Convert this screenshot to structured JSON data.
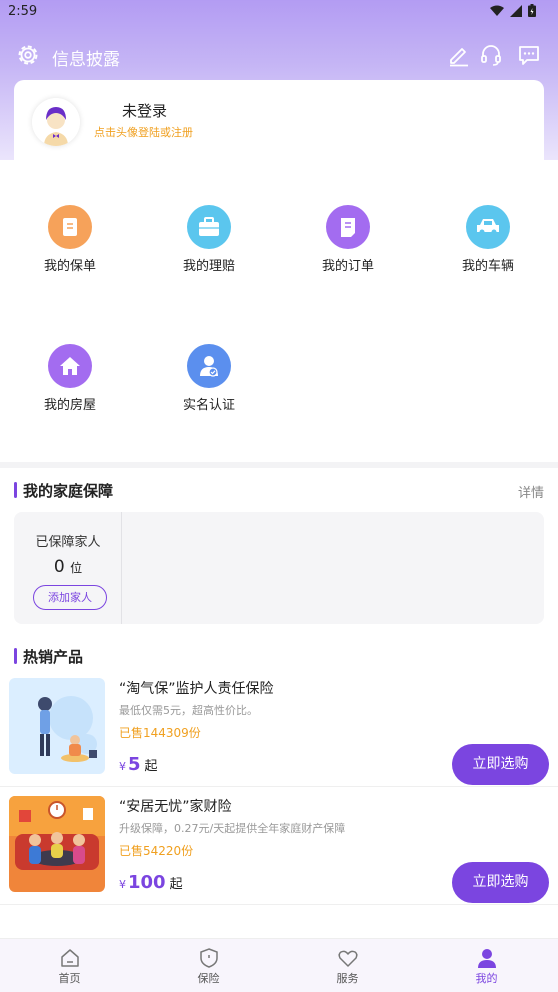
{
  "status_bar": {
    "time": "2:59"
  },
  "header": {
    "title": "信息披露"
  },
  "profile": {
    "name": "未登录",
    "hint": "点击头像登陆或注册"
  },
  "quick_grid": [
    {
      "label": "我的保单",
      "icon": "policy-icon",
      "color": "#f6a25a"
    },
    {
      "label": "我的理赔",
      "icon": "briefcase-icon",
      "color": "#5bc6ee"
    },
    {
      "label": "我的订单",
      "icon": "order-icon",
      "color": "#a36cf0"
    },
    {
      "label": "我的车辆",
      "icon": "car-icon",
      "color": "#5bc6ee"
    },
    {
      "label": "我的房屋",
      "icon": "house-icon",
      "color": "#a36cf0"
    },
    {
      "label": "实名认证",
      "icon": "verify-icon",
      "color": "#5b8fee"
    }
  ],
  "family": {
    "section_title": "我的家庭保障",
    "more": "详情",
    "label": "已保障家人",
    "count": "0",
    "unit": "位",
    "add_button": "添加家人"
  },
  "hot": {
    "section_title": "热销产品",
    "products": [
      {
        "name": "“淘气保”监护人责任保险",
        "desc": "最低仅需5元，超高性价比。",
        "sold": "已售144309份",
        "currency": "¥",
        "price": "5",
        "suffix": "起",
        "button": "立即选购"
      },
      {
        "name": "“安居无忧”家财险",
        "desc": "升级保障，0.27元/天起提供全年家庭财产保障",
        "sold": "已售54220份",
        "currency": "¥",
        "price": "100",
        "suffix": "起",
        "button": "立即选购"
      }
    ]
  },
  "tabs": [
    {
      "label": "首页",
      "icon": "home-icon"
    },
    {
      "label": "保险",
      "icon": "shield-icon"
    },
    {
      "label": "服务",
      "icon": "heart-icon"
    },
    {
      "label": "我的",
      "icon": "user-icon",
      "active": true
    }
  ],
  "colors": {
    "accent": "#7b45e0",
    "sold": "#f0a020"
  }
}
